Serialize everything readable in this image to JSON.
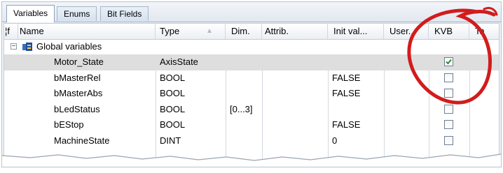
{
  "tabs": [
    {
      "label": "Variables",
      "active": true
    },
    {
      "label": "Enums",
      "active": false
    },
    {
      "label": "Bit Fields",
      "active": false
    }
  ],
  "columns": {
    "flag": "¦f",
    "name": "Name",
    "type": "Type",
    "dim": "Dim.",
    "attrib": "Attrib.",
    "init": "Init val...",
    "user": "User...",
    "kvb": "KVB",
    "tag": "Ta"
  },
  "group": {
    "label": "Global variables",
    "expander": "−",
    "icon": "global-variables-icon"
  },
  "rows": [
    {
      "name": "Motor_State",
      "type": "AxisState",
      "dim": "",
      "init": "",
      "kvb": true,
      "selected": true
    },
    {
      "name": "bMasterRel",
      "type": "BOOL",
      "dim": "",
      "init": "FALSE",
      "kvb": false,
      "selected": false
    },
    {
      "name": "bMasterAbs",
      "type": "BOOL",
      "dim": "",
      "init": "FALSE",
      "kvb": false,
      "selected": false
    },
    {
      "name": "bLedStatus",
      "type": "BOOL",
      "dim": "[0...3]",
      "init": "",
      "kvb": false,
      "selected": false
    },
    {
      "name": "bEStop",
      "type": "BOOL",
      "dim": "",
      "init": "FALSE",
      "kvb": false,
      "selected": false
    },
    {
      "name": "MachineState",
      "type": "DINT",
      "dim": "",
      "init": "0",
      "kvb": false,
      "selected": false
    }
  ],
  "colors": {
    "annotation": "#d21c1c",
    "check": "#2f8a2f",
    "selected_row": "#dedede"
  }
}
